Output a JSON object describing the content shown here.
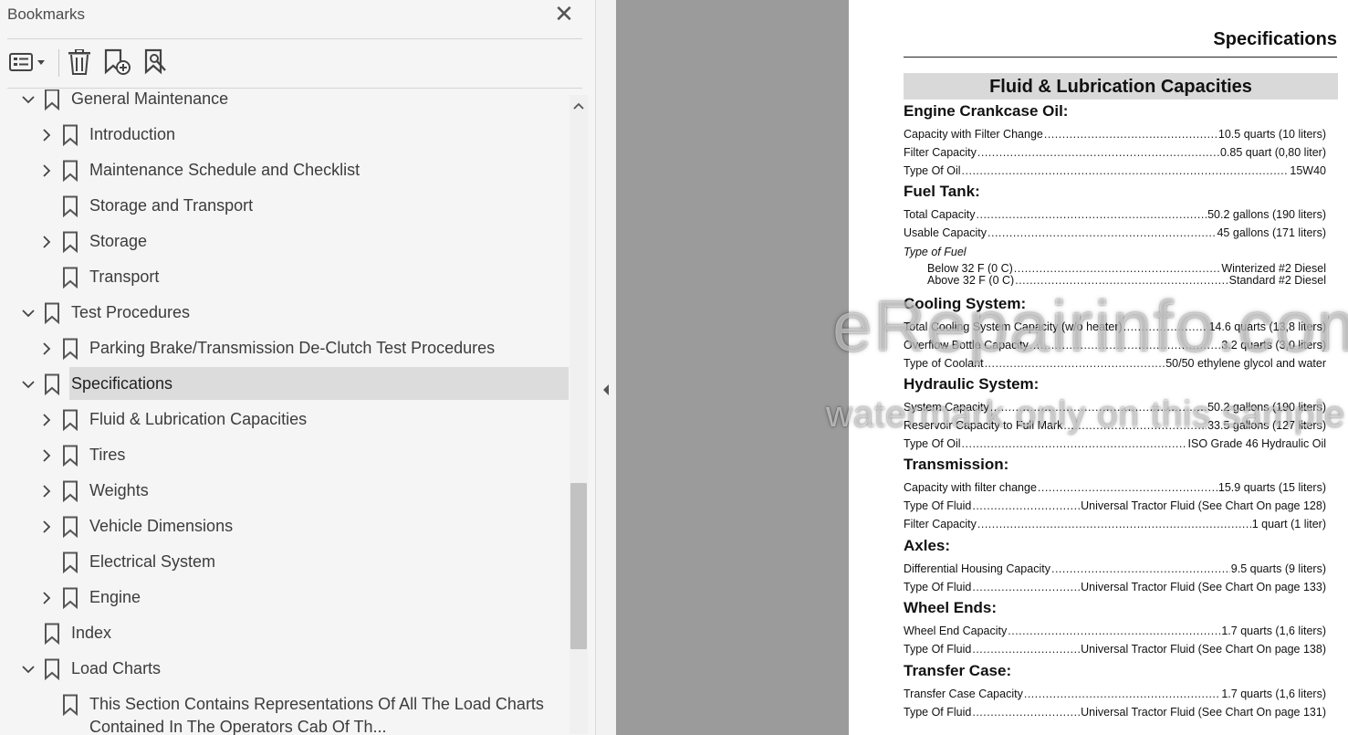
{
  "panel": {
    "title": "Bookmarks",
    "close_glyph": "✕",
    "toolbar": [
      {
        "name": "options-menu",
        "icon": "list-options-icon"
      },
      {
        "name": "delete-bookmark",
        "icon": "trash-icon"
      },
      {
        "name": "add-bookmark",
        "icon": "bookmark-add-icon"
      },
      {
        "name": "find-bookmark",
        "icon": "bookmark-search-icon"
      }
    ]
  },
  "tree": {
    "items": [
      {
        "label": "General Maintenance",
        "level": 0,
        "expander": "down",
        "selected": false
      },
      {
        "label": "Introduction",
        "level": 1,
        "expander": "right",
        "selected": false
      },
      {
        "label": "Maintenance Schedule and Checklist",
        "level": 1,
        "expander": "right",
        "selected": false
      },
      {
        "label": "Storage and Transport",
        "level": 1,
        "expander": "none",
        "selected": false
      },
      {
        "label": "Storage",
        "level": 1,
        "expander": "right",
        "selected": false
      },
      {
        "label": "Transport",
        "level": 1,
        "expander": "none",
        "selected": false
      },
      {
        "label": "Test Procedures",
        "level": 0,
        "expander": "down",
        "selected": false
      },
      {
        "label": "Parking Brake/Transmission De-Clutch Test Procedures",
        "level": 1,
        "expander": "right",
        "selected": false
      },
      {
        "label": "Specifications",
        "level": 0,
        "expander": "down",
        "selected": true
      },
      {
        "label": "Fluid & Lubrication Capacities",
        "level": 1,
        "expander": "right",
        "selected": false
      },
      {
        "label": "Tires",
        "level": 1,
        "expander": "right",
        "selected": false
      },
      {
        "label": "Weights",
        "level": 1,
        "expander": "right",
        "selected": false
      },
      {
        "label": "Vehicle Dimensions",
        "level": 1,
        "expander": "right",
        "selected": false
      },
      {
        "label": "Electrical System",
        "level": 1,
        "expander": "none",
        "selected": false
      },
      {
        "label": "Engine",
        "level": 1,
        "expander": "right",
        "selected": false
      },
      {
        "label": "Index",
        "level": 0,
        "expander": "none",
        "selected": false
      },
      {
        "label": "Load Charts",
        "level": 0,
        "expander": "down",
        "selected": false
      },
      {
        "label": "This Section Contains Representations Of All The Load Charts",
        "label_line2": "Contained In The Operators Cab Of Th...",
        "level": 1,
        "expander": "none",
        "selected": false
      }
    ]
  },
  "document": {
    "header": "Specifications",
    "section_title": "Fluid & Lubrication Capacities",
    "sections": [
      {
        "title": "Engine Crankcase Oil:",
        "rows": [
          {
            "k": "Capacity with Filter Change",
            "v": "10.5 quarts (10 liters)"
          },
          {
            "k": "Filter Capacity",
            "v": "0.85 quart (0,80 liter)"
          },
          {
            "k": "Type Of Oil",
            "v": "15W40"
          }
        ]
      },
      {
        "title": "Fuel Tank:",
        "rows": [
          {
            "k": "Total Capacity",
            "v": "50.2 gallons (190 liters)"
          },
          {
            "k": "Usable Capacity",
            "v": "45 gallons (171 liters)"
          }
        ],
        "note": "Type of Fuel",
        "subrows": [
          {
            "k": "Below 32  F (0  C)",
            "v": "Winterized #2 Diesel"
          },
          {
            "k": "Above 32  F (0  C)",
            "v": "Standard #2 Diesel"
          }
        ]
      },
      {
        "title": "Cooling System:",
        "rows": [
          {
            "k": "Total Cooling System Capacity (w/o heater)",
            "v": "14.6 quarts (13,8 liters)"
          },
          {
            "k": "Overflow Bottle Capacity",
            "v": "3.2 quarts (3,0 liters)"
          },
          {
            "k": "Type of Coolant",
            "v": "50/50 ethylene glycol and water"
          }
        ]
      },
      {
        "title": "Hydraulic System:",
        "rows": [
          {
            "k": "System Capacity",
            "v": "50.2 gallons (190 liters)"
          },
          {
            "k": "Reservoir Capacity to Full Mark",
            "v": "33.5 gallons (127 liters)"
          },
          {
            "k": "Type Of Oil",
            "v": "ISO Grade 46 Hydraulic Oil"
          }
        ]
      },
      {
        "title": "Transmission:",
        "rows": [
          {
            "k": "Capacity with filter change",
            "v": "15.9 quarts (15 liters)"
          },
          {
            "k": "Type Of Fluid",
            "v": "Universal Tractor Fluid (See Chart On page 128)"
          },
          {
            "k": "Filter Capacity",
            "v": "1 quart (1 liter)"
          }
        ]
      },
      {
        "title": "Axles:",
        "rows": [
          {
            "k": "Differential Housing Capacity",
            "v": "9.5 quarts (9 liters)"
          },
          {
            "k": "Type Of Fluid",
            "v": "Universal Tractor Fluid (See Chart On page 133)"
          }
        ]
      },
      {
        "title": "Wheel Ends:",
        "rows": [
          {
            "k": "Wheel End Capacity",
            "v": "1.7 quarts (1,6 liters)"
          },
          {
            "k": "Type Of Fluid",
            "v": "Universal Tractor Fluid (See Chart On page 138)"
          }
        ]
      },
      {
        "title": "Transfer Case:",
        "rows": [
          {
            "k": "Transfer Case Capacity",
            "v": "1.7 quarts (1,6 liters)"
          },
          {
            "k": "Type Of Fluid",
            "v": "Universal Tractor Fluid (See Chart On page 131)"
          }
        ]
      }
    ]
  },
  "watermark": {
    "line1": "eRepairinfo.com",
    "line2": "watermark only on this sample"
  }
}
